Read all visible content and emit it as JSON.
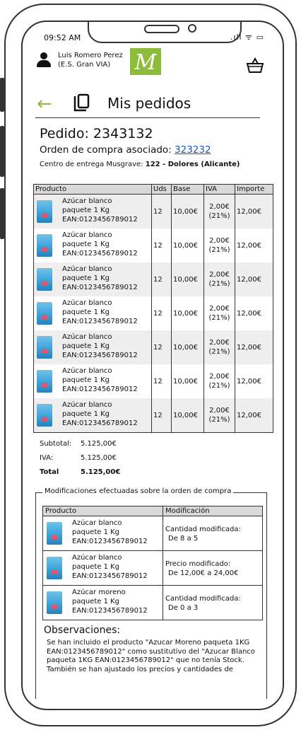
{
  "status": {
    "time": "09:52 AM",
    "icons": ".ıll ᯤ ▭"
  },
  "user": {
    "name": "Luis Romero Perez",
    "store": "(E.S. Gran VIA)",
    "logo_letter": "M"
  },
  "header": {
    "title": "Mis pedidos"
  },
  "order": {
    "title": "Pedido: 2343132",
    "po_label": "Orden de compra asociado: ",
    "po_number": "323232",
    "center_label": "Centro de entrega Musgrave:",
    "center_value": "122 - Dolores (Alicante)"
  },
  "products_table": {
    "headers": [
      "Producto",
      "Uds",
      "Base",
      "IVA",
      "Importe"
    ],
    "rows": [
      {
        "line1": "Azúcar blanco",
        "line2": "paquete 1 Kg",
        "line3": "EAN:0123456789012",
        "uds": "12",
        "base": "10,00€",
        "iva1": "2,00€",
        "iva2": "(21%)",
        "importe": "12,00€"
      },
      {
        "line1": "Azúcar blanco",
        "line2": "paquete 1 Kg",
        "line3": "EAN:0123456789012",
        "uds": "12",
        "base": "10,00€",
        "iva1": "2,00€",
        "iva2": "(21%)",
        "importe": "12,00€"
      },
      {
        "line1": "Azúcar blanco",
        "line2": "paquete 1 Kg",
        "line3": "EAN:0123456789012",
        "uds": "12",
        "base": "10,00€",
        "iva1": "2,00€",
        "iva2": "(21%)",
        "importe": "12,00€"
      },
      {
        "line1": "Azúcar blanco",
        "line2": "paquete 1 Kg",
        "line3": "EAN:0123456789012",
        "uds": "12",
        "base": "10,00€",
        "iva1": "2,00€",
        "iva2": "(21%)",
        "importe": "12,00€"
      },
      {
        "line1": "Azúcar blanco",
        "line2": "paquete 1 Kg",
        "line3": "EAN:0123456789012",
        "uds": "12",
        "base": "10,00€",
        "iva1": "2,00€",
        "iva2": "(21%)",
        "importe": "12,00€"
      },
      {
        "line1": "Azúcar blanco",
        "line2": "paquete 1 Kg",
        "line3": "EAN:0123456789012",
        "uds": "12",
        "base": "10,00€",
        "iva1": "2,00€",
        "iva2": "(21%)",
        "importe": "12,00€"
      },
      {
        "line1": "Azúcar blanco",
        "line2": "paquete 1 Kg",
        "line3": "EAN:0123456789012",
        "uds": "12",
        "base": "10,00€",
        "iva1": "2,00€",
        "iva2": "(21%)",
        "importe": "12,00€"
      }
    ]
  },
  "totals": {
    "subtotal_label": "Subtotal:",
    "subtotal_value": "5.125,00€",
    "iva_label": "IVA:",
    "iva_value": "5.125,00€",
    "total_label": "Total",
    "total_value": "5.125,00€"
  },
  "modifications": {
    "legend": "Modificaciones efectuadas sobre la orden de compra",
    "headers": [
      "Producto",
      "Modificación"
    ],
    "rows": [
      {
        "line1": "Azúcar blanco",
        "line2": "paquete 1 Kg",
        "line3": "EAN:0123456789012",
        "mod1": "Cantidad modificada:",
        "mod2": "De 8 a 5"
      },
      {
        "line1": "Azúcar blanco",
        "line2": "paquete 1 Kg",
        "line3": "EAN:0123456789012",
        "mod1": "Precio modificado:",
        "mod2": "De 12,00€ a 24,00€"
      },
      {
        "line1": "Azúcar moreno",
        "line2": "paquete 1 Kg",
        "line3": "EAN:0123456789012",
        "mod1": "Cantidad modificada:",
        "mod2": "De 0 a 3"
      }
    ]
  },
  "observations": {
    "title": "Observaciones:",
    "text": "Se han incluido el producto \"Azucar Moreno paqueta 1KG EAN:0123456789012\" como sustitutivo del \"Azucar Blanco paqueta 1KG EAN:0123456789012\" que no tenía Stock. También se han ajustado los precios y cantidades de"
  },
  "colors": {
    "accent": "#8dbb3c",
    "link": "#1a55c8",
    "header_bg": "#d9d9d9",
    "row_alt": "#eeeeee"
  }
}
